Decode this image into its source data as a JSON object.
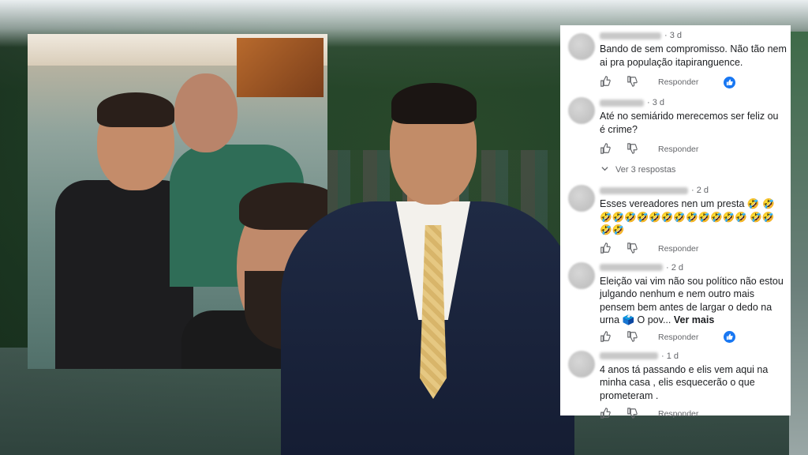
{
  "comments": [
    {
      "time": "3 d",
      "text": "Bando de sem compromisso. Não tão nem ai pra população itapiranguence.",
      "reply_label": "Responder",
      "has_like_badge": true
    },
    {
      "time": "3 d",
      "text": "Até no semiárido merecemos ser feliz ou é crime?",
      "reply_label": "Responder",
      "has_like_badge": false,
      "replies_label": "Ver 3 respostas"
    },
    {
      "time": "2 d",
      "text": "Esses vereadores nen um presta 🤣 🤣🤣🤣🤣🤣🤣🤣🤣🤣🤣🤣🤣🤣 🤣🤣🤣🤣",
      "reply_label": "Responder",
      "has_like_badge": false
    },
    {
      "time": "2 d",
      "text": "Eleição vai vim não sou político não estou julgando nenhum e nem outro mais pensem bem antes de largar o dedo na urna 🗳️ O pov...",
      "more_label": "Ver mais",
      "reply_label": "Responder",
      "has_like_badge": true
    },
    {
      "time": "1 d",
      "text": "4 anos tá passando e elis vem aqui na minha casa , elis esquecerão o que prometeram .",
      "reply_label": "Responder",
      "has_like_badge": false
    }
  ],
  "colors": {
    "accent": "#1877f2",
    "muted_text": "#65676b",
    "panel_bg": "#ffffff"
  },
  "icons": {
    "like": "thumbs-up-icon",
    "dislike": "thumbs-down-icon",
    "like_badge": "like-reaction-icon",
    "replies": "chevron-down-icon"
  }
}
